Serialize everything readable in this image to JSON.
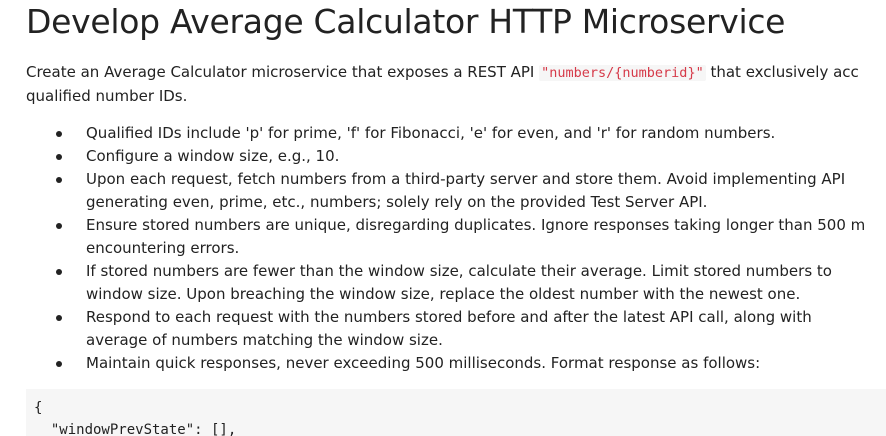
{
  "title": "Develop Average Calculator HTTP Microservice",
  "intro": {
    "line1_before": "Create an Average Calculator microservice that exposes a REST API ",
    "api_path": "\"numbers/{numberid}\"",
    "line1_after": " that exclusively acc",
    "line2": "qualified number IDs."
  },
  "requirements": [
    {
      "lines": [
        "Qualified IDs include 'p' for prime, 'f' for Fibonacci, 'e' for even, and 'r' for random numbers."
      ]
    },
    {
      "lines": [
        "Configure a window size, e.g., 10."
      ]
    },
    {
      "lines": [
        "Upon each request, fetch numbers from a third-party server and store them. Avoid implementing API",
        "generating even, prime, etc., numbers; solely rely on the provided Test Server API."
      ]
    },
    {
      "lines": [
        "Ensure stored numbers are unique, disregarding duplicates. Ignore responses taking longer than 500 m",
        "encountering errors."
      ]
    },
    {
      "lines": [
        "If stored numbers are fewer than the window size, calculate their average. Limit stored numbers to",
        "window size. Upon breaching the window size, replace the oldest number with the newest one."
      ]
    },
    {
      "lines": [
        "Respond to each request with the numbers stored before and after the latest API call, along with",
        "average of numbers matching the window size."
      ]
    },
    {
      "lines": [
        "Maintain quick responses, never exceeding 500 milliseconds. Format response as follows:"
      ]
    }
  ],
  "code_block": {
    "lines": [
      "{",
      "  \"windowPrevState\": [],"
    ]
  }
}
